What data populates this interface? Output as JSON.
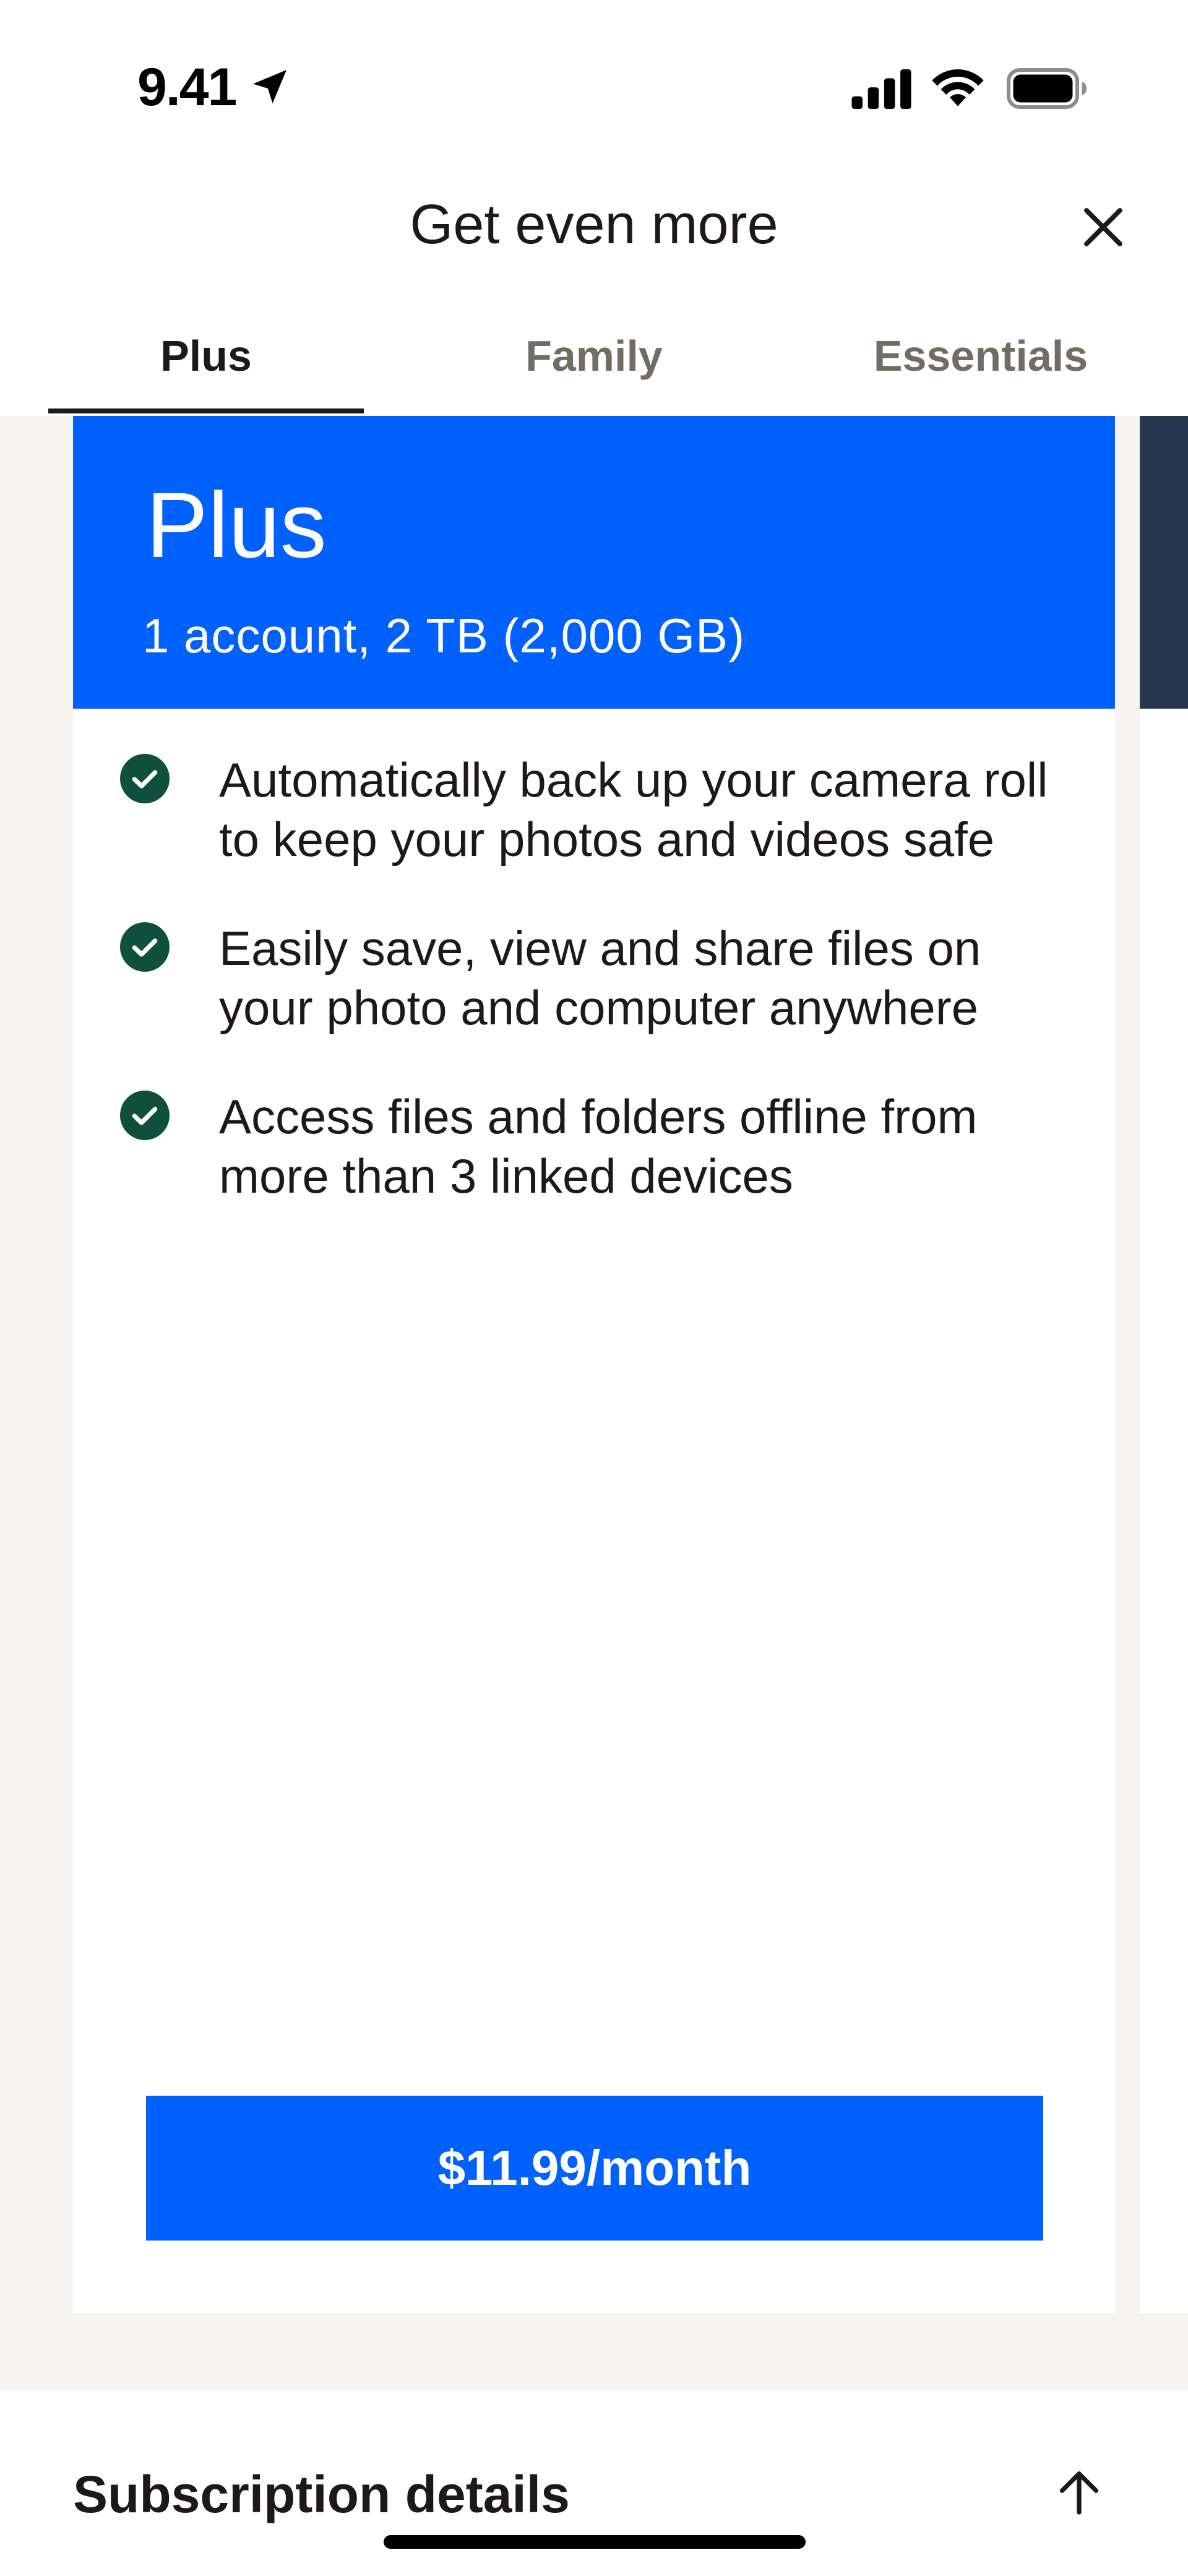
{
  "status_bar": {
    "time": "9.41",
    "icons": [
      "location-arrow-icon",
      "cellular-signal-icon",
      "wifi-icon",
      "battery-icon"
    ]
  },
  "header": {
    "title": "Get even more",
    "close_icon": "close-icon"
  },
  "tabs": [
    {
      "label": "Plus",
      "selected": true
    },
    {
      "label": "Family",
      "selected": false
    },
    {
      "label": "Essentials",
      "selected": false
    }
  ],
  "plan": {
    "name": "Plus",
    "storage": "1 account, 2 TB (2,000 GB)",
    "features": [
      "Automatically back up your camera roll to keep your photos and videos safe",
      "Easily save, view and share files on your photo and computer anywhere",
      "Access files and folders offline from more than 3 linked devices"
    ],
    "price_label": "$11.99/month"
  },
  "subscription": {
    "title": "Subscription details",
    "toggle_icon": "arrow-up-icon"
  },
  "colors": {
    "brand_blue": "#0061fe",
    "check_green": "#0f503c",
    "next_card_navy": "#283750",
    "page_background": "#f7f5f2",
    "text_primary": "#1e1919",
    "text_secondary": "#736c64"
  }
}
